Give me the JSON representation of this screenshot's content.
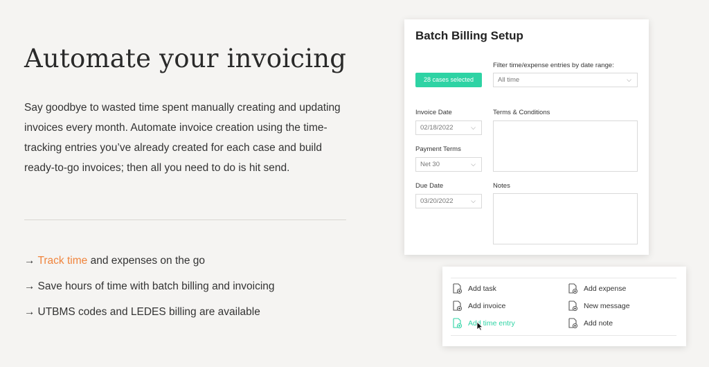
{
  "hero": {
    "headline": "Automate your invoicing",
    "intro": "Say goodbye to wasted time spent manually creating and updating invoices every month. Automate invoice creation using the time-tracking entries you’ve already created for each case and build ready-to-go invoices; then all you need to do is hit send."
  },
  "bullets": {
    "arrow": "→",
    "item1_link": "Track time",
    "item1_rest": " and expenses on the go",
    "item2": "Save hours of time with batch billing and invoicing",
    "item3": "UTBMS codes and LEDES billing are available"
  },
  "billing_card": {
    "title": "Batch Billing Setup",
    "cases_badge": "28 cases selected",
    "filter_label": "Filter time/expense entries by date range:",
    "filter_value": "All time",
    "invoice_date_label": "Invoice Date",
    "invoice_date_value": "02/18/2022",
    "payment_terms_label": "Payment Terms",
    "payment_terms_value": "Net 30",
    "due_date_label": "Due Date",
    "due_date_value": "03/20/2022",
    "terms_label": "Terms & Conditions",
    "notes_label": "Notes",
    "chevron": "⌵"
  },
  "actions": {
    "add_task": "Add task",
    "add_expense": "Add expense",
    "add_invoice": "Add invoice",
    "new_message": "New message",
    "add_time_entry": "Add time entry",
    "add_note": "Add note"
  },
  "colors": {
    "accent": "#f0843c",
    "brand_green": "#2ed3a4"
  }
}
